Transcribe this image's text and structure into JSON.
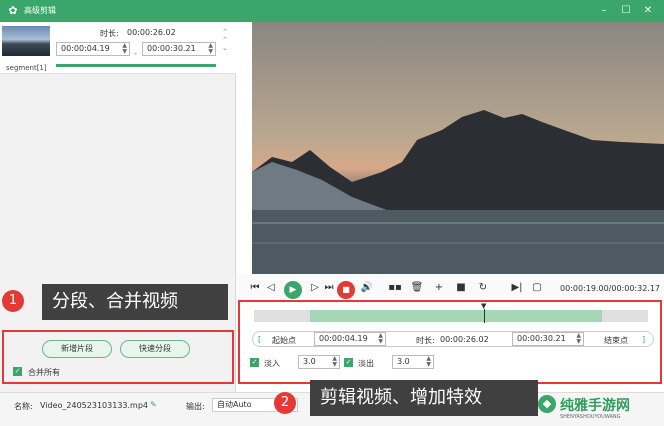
{
  "window": {
    "title": "高级剪辑"
  },
  "segment": {
    "label": "segment[1]",
    "duration_label": "时长:",
    "duration_value": "00:00:26.02",
    "start": "00:00:04.19",
    "end": "00:00:30.21",
    "separator": "-"
  },
  "callouts": {
    "one": {
      "number": "1",
      "text": "分段、合并视频"
    },
    "two": {
      "number": "2",
      "text": "剪辑视频、增加特效"
    }
  },
  "left_actions": {
    "new_segment": "新增片段",
    "quick_split": "快速分段",
    "merge_all": "合并所有"
  },
  "player": {
    "time_display": "00:00:19.00/00:00:32.17"
  },
  "trim": {
    "start_button": "起始点",
    "start_value": "00:00:04.19",
    "duration_label": "时长:",
    "duration_value": "00:00:26.02",
    "end_value": "00:00:30.21",
    "end_button": "结束点",
    "fade_in_label": "淡入",
    "fade_in_value": "3.0",
    "fade_out_label": "淡出",
    "fade_out_value": "3.0"
  },
  "bottom": {
    "name_label": "名称:",
    "file_name": "Video_240523103133.mp4",
    "output_label": "输出:",
    "output_value": "自动Auto"
  },
  "watermark": {
    "text": "纯雅手游网",
    "subtext": "SHENYASHOUYOUWANG"
  },
  "colors": {
    "accent": "#3aa66a",
    "highlight": "#e53935"
  }
}
